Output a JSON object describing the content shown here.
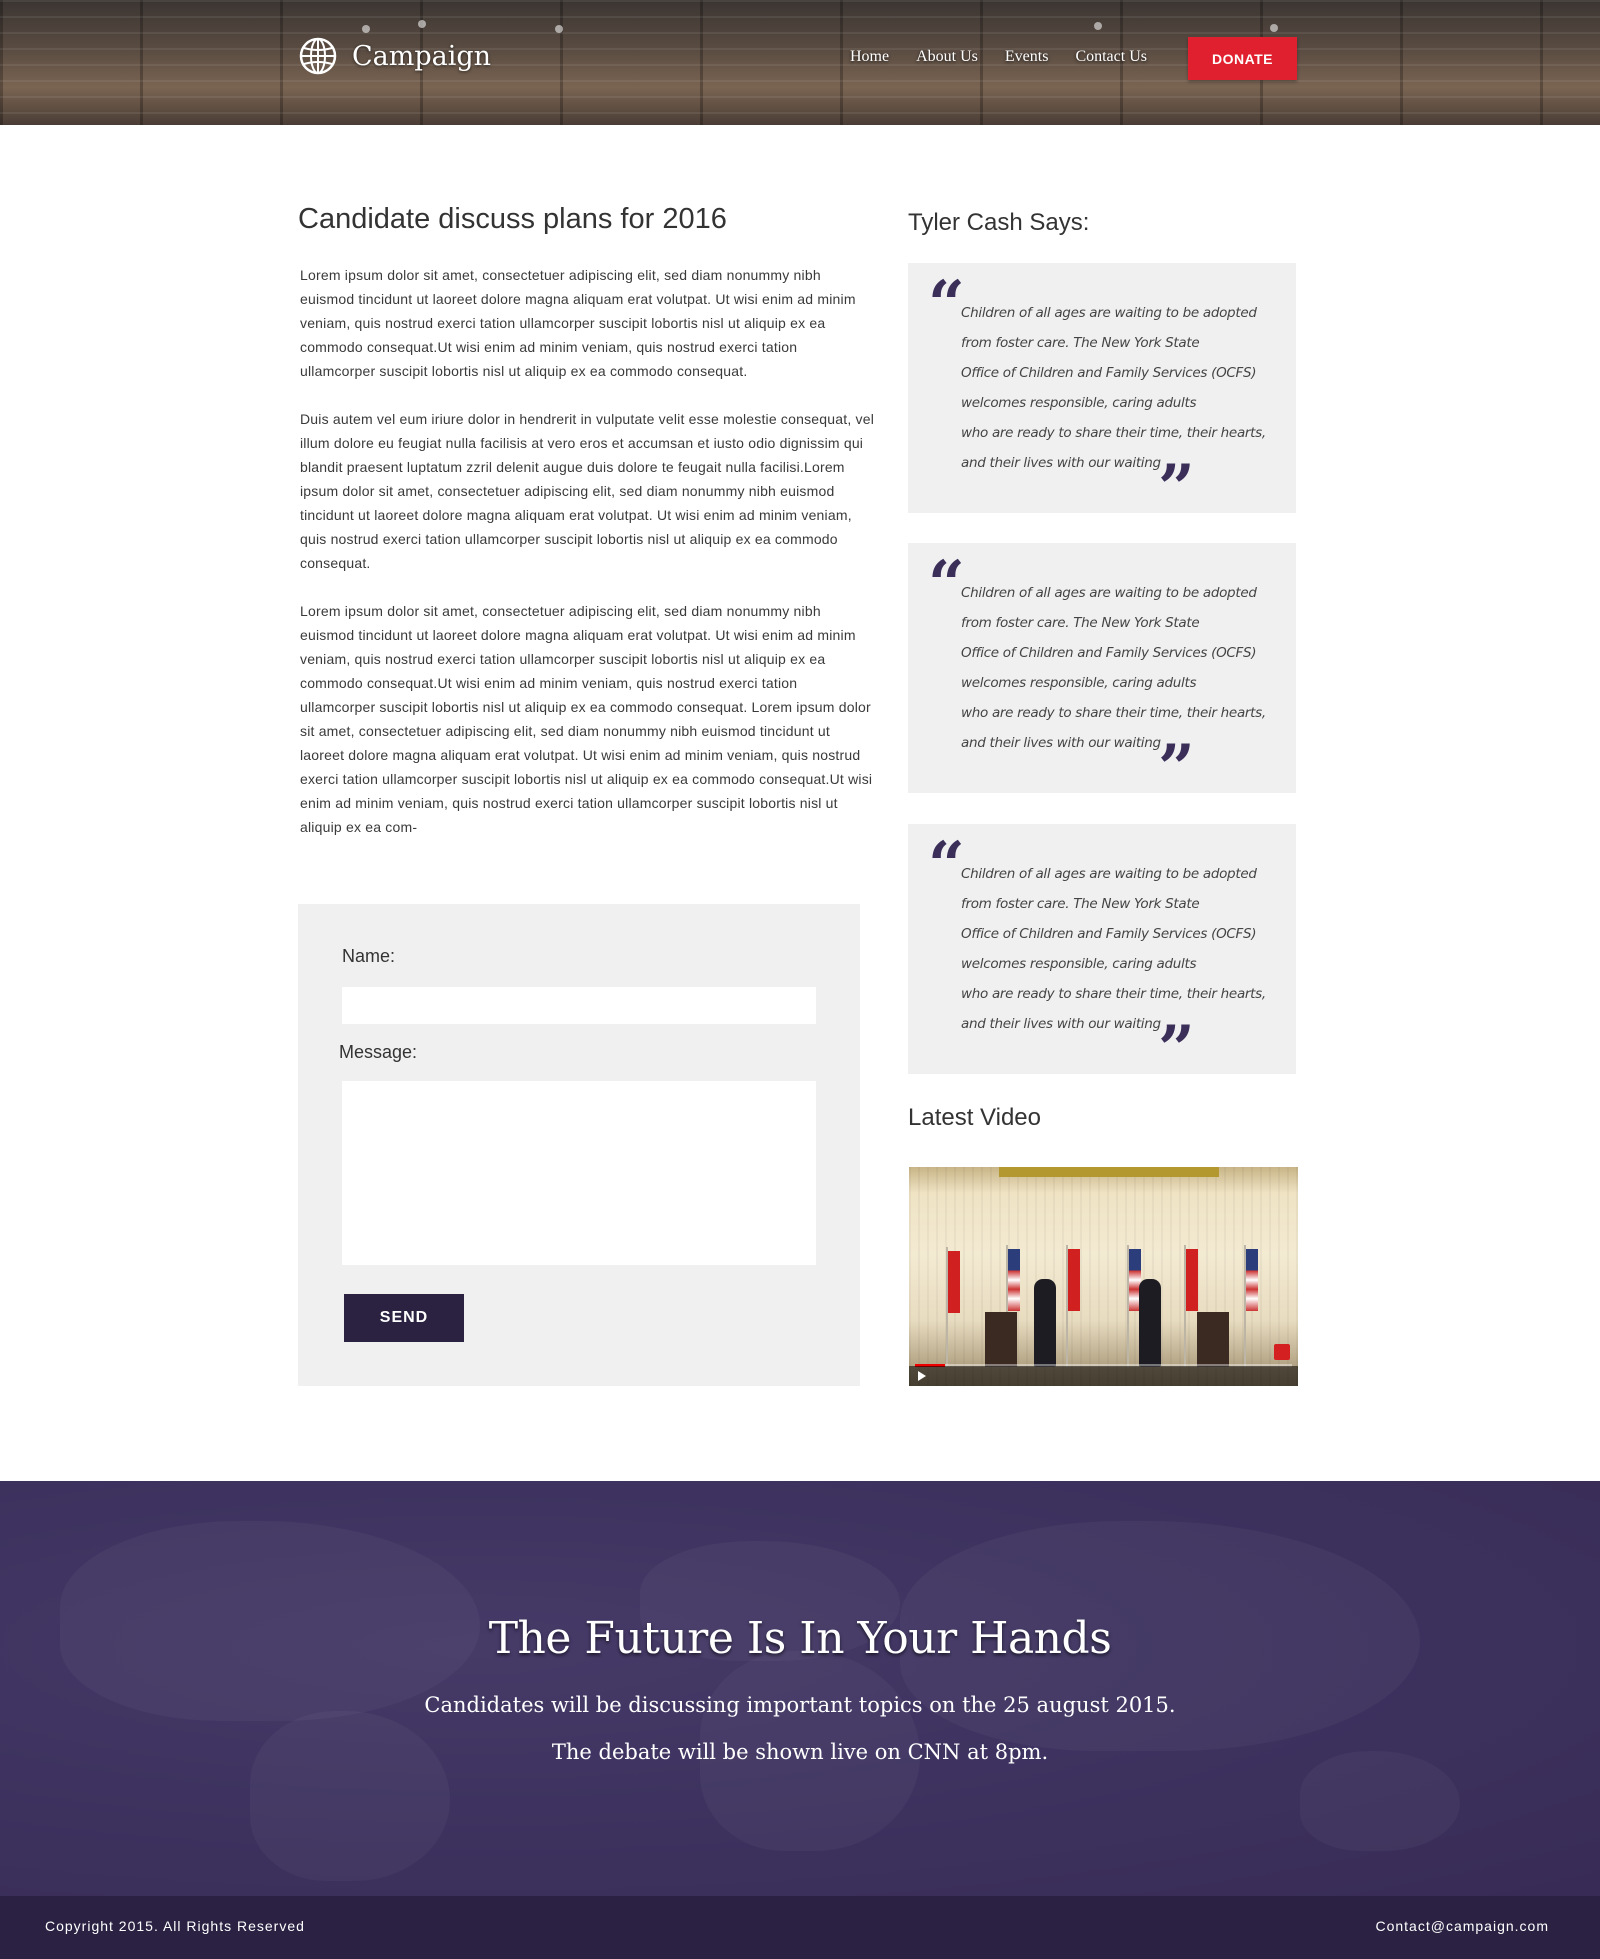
{
  "header": {
    "logo_text": "Campaign",
    "nav": [
      "Home",
      "About Us",
      "Events",
      "Contact Us"
    ],
    "donate_label": "DONATE"
  },
  "article": {
    "title": "Candidate discuss plans for 2016",
    "paragraphs": [
      "Lorem ipsum dolor sit amet, consectetuer adipiscing elit, sed diam nonummy nibh euismod tincidunt ut laoreet dolore magna aliquam erat volutpat. Ut wisi enim ad minim veniam, quis nostrud exerci tation ullamcorper suscipit lobortis nisl ut aliquip ex ea commodo consequat.Ut wisi enim ad minim veniam, quis nostrud exerci tation ullamcorper suscipit lobortis nisl ut aliquip ex ea commodo consequat.",
      "Duis autem vel eum iriure dolor in hendrerit in vulputate velit esse molestie consequat, vel illum dolore eu feugiat nulla facilisis at vero eros et accumsan et iusto odio dignissim qui blandit praesent luptatum zzril delenit augue duis dolore te feugait nulla facilisi.Lorem ipsum dolor sit amet, consectetuer adipiscing elit, sed diam nonummy nibh euismod tincidunt ut laoreet dolore magna aliquam erat volutpat. Ut wisi enim ad minim veniam, quis nostrud exerci tation ullamcorper suscipit lobortis nisl ut aliquip ex ea commodo consequat.",
      "Lorem ipsum dolor sit amet, consectetuer adipiscing elit, sed diam nonummy nibh euismod tincidunt ut laoreet dolore magna aliquam erat volutpat. Ut wisi enim ad minim veniam, quis nostrud exerci tation ullamcorper suscipit lobortis nisl ut aliquip ex ea commodo consequat.Ut wisi enim ad minim veniam, quis nostrud exerci tation ullamcorper suscipit lobortis nisl ut aliquip ex ea commodo consequat. Lorem ipsum dolor sit amet, consectetuer adipiscing elit, sed diam nonummy nibh euismod tincidunt ut laoreet dolore magna aliquam erat volutpat. Ut wisi enim ad minim veniam, quis nostrud exerci tation ullamcorper suscipit lobortis nisl ut aliquip ex ea commodo consequat.Ut wisi enim ad minim veniam, quis nostrud exerci tation ullamcorper suscipit lobortis nisl ut aliquip ex ea com-"
    ]
  },
  "form": {
    "name_label": "Name:",
    "name_value": "",
    "message_label": "Message:",
    "message_value": "",
    "send_label": "SEND"
  },
  "sidebar": {
    "quotes_title": "Tyler Cash Says:",
    "quotes": [
      {
        "lines": [
          "Children of all ages are waiting to be adopted",
          "from foster care. The New York State",
          "Office of Children and Family Services (OCFS)",
          "welcomes responsible, caring adults",
          "who are ready to share their time, their hearts,",
          "and their lives with our waiting"
        ]
      },
      {
        "lines": [
          "Children of all ages are waiting to be adopted",
          "from foster care. The New York State",
          "Office of Children and Family Services (OCFS)",
          "welcomes responsible, caring adults",
          "who are ready to share their time, their hearts,",
          "and their lives with our waiting"
        ]
      },
      {
        "lines": [
          "Children of all ages are waiting to be adopted",
          "from foster care. The New York State",
          "Office of Children and Family Services (OCFS)",
          "welcomes responsible, caring adults",
          "who are ready to share their time, their hearts,",
          "and their lives with our waiting"
        ]
      }
    ],
    "video_title": "Latest Video"
  },
  "cta": {
    "title": "The Future Is In Your Hands",
    "line1": "Candidates will be discussing important topics on the 25 august 2015.",
    "line2": "The debate will be shown live on CNN at 8pm."
  },
  "footer": {
    "copyright": "Copyright 2015. All Rights Reserved",
    "contact": "Contact@campaign.com"
  },
  "colors": {
    "accent_red": "#e0202e",
    "brand_purple": "#3e3360",
    "footer_purple": "#2b2243",
    "button_dark": "#2a2240"
  }
}
